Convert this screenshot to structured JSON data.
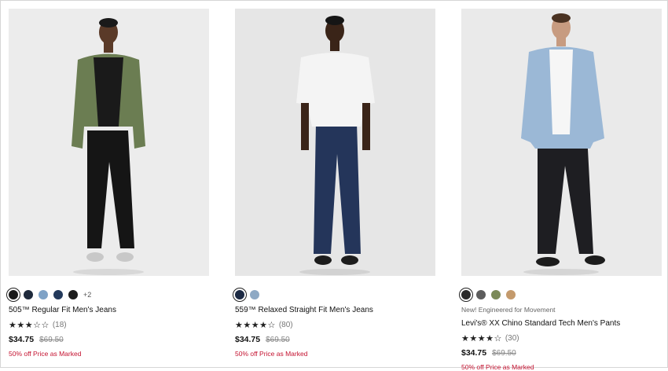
{
  "products": [
    {
      "colors": [
        "#1b1b1b",
        "#1f2a3c",
        "#7fa2c6",
        "#23395b",
        "#1c1c1c"
      ],
      "selected_color": 0,
      "more_colors": "+2",
      "tag": "",
      "name": "505™ Regular Fit Men's Jeans",
      "stars": "★★★☆☆",
      "review_count": "(18)",
      "price": "$34.75",
      "original_price": "$69.50",
      "promo": "50% off Price as Marked"
    },
    {
      "colors": [
        "#1c2a44",
        "#8ea9c4"
      ],
      "selected_color": 0,
      "more_colors": "",
      "tag": "",
      "name": "559™ Relaxed Straight Fit Men's Jeans",
      "stars": "★★★★☆",
      "review_count": "(80)",
      "price": "$34.75",
      "original_price": "$69.50",
      "promo": "50% off Price as Marked"
    },
    {
      "colors": [
        "#2a2a2a",
        "#5c5c5c",
        "#7b8a58",
        "#c49a6c"
      ],
      "selected_color": 0,
      "more_colors": "",
      "tag": "New! Engineered for Movement",
      "name": "Levi's® XX Chino Standard Tech Men's Pants",
      "stars": "★★★★☆",
      "review_count": "(30)",
      "price": "$34.75",
      "original_price": "$69.50",
      "promo": "50% off Price as Marked"
    }
  ]
}
